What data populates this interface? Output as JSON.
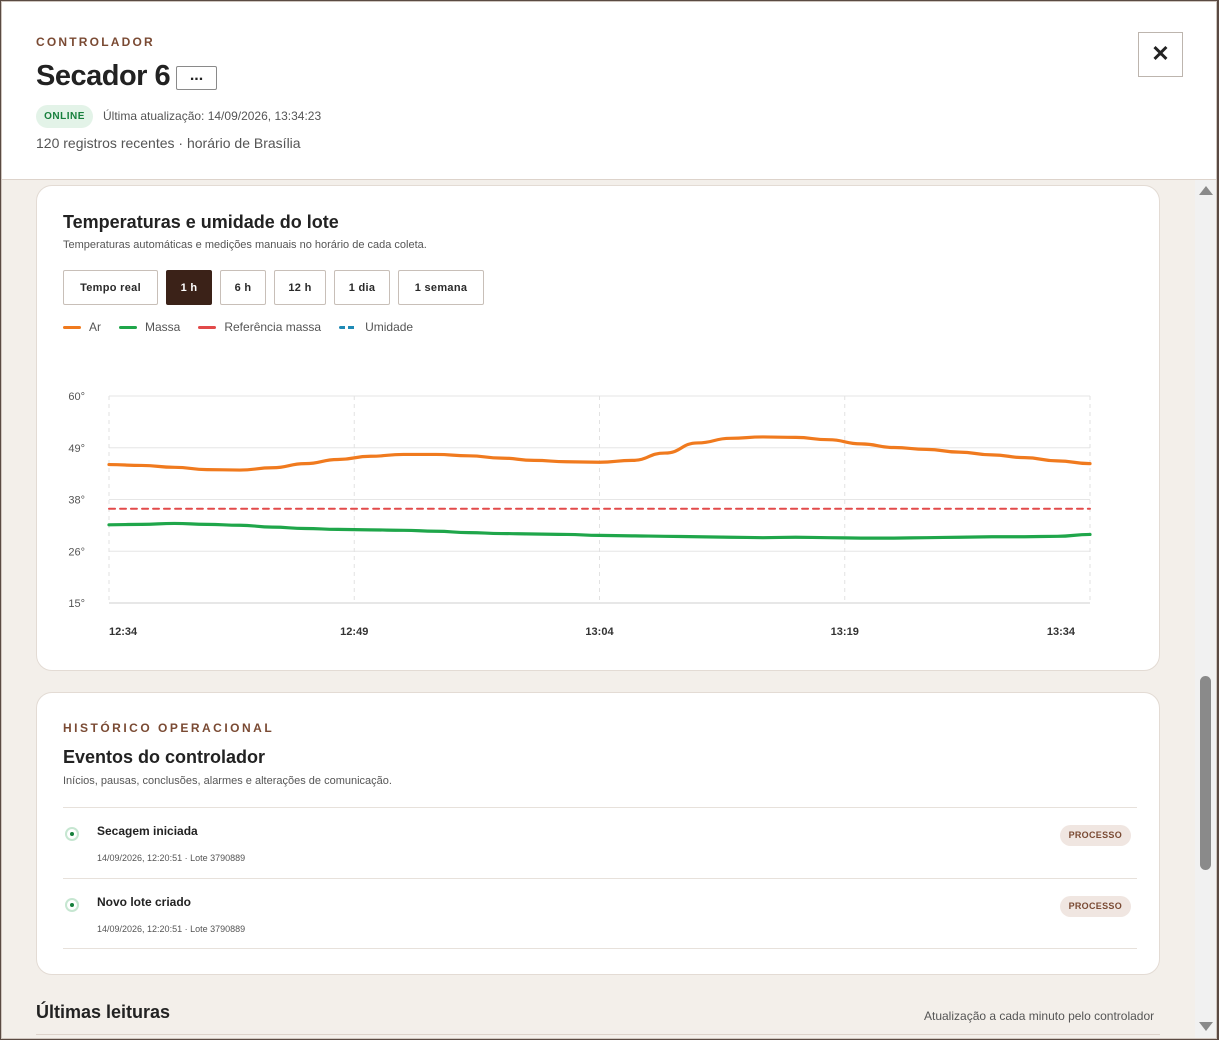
{
  "header": {
    "eyebrow": "CONTROLADOR",
    "title": "Secador 6",
    "more_label": "...",
    "status": "ONLINE",
    "last_update": "Última atualização: 14/09/2026, 13:34:23",
    "records": "120 registros recentes · horário de Brasília",
    "close_label": "✕"
  },
  "chart_card": {
    "title": "Temperaturas e umidade do lote",
    "subtitle": "Temperaturas automáticas e medições manuais no horário de cada coleta.",
    "ranges": [
      {
        "label": "Tempo real",
        "active": false
      },
      {
        "label": "1 h",
        "active": true
      },
      {
        "label": "6 h",
        "active": false
      },
      {
        "label": "12 h",
        "active": false
      },
      {
        "label": "1 dia",
        "active": false
      },
      {
        "label": "1 semana",
        "active": false
      }
    ],
    "legend": [
      {
        "name": "Ar",
        "color": "#f07a1e",
        "style": "solid"
      },
      {
        "name": "Massa",
        "color": "#1fa64a",
        "style": "solid"
      },
      {
        "name": "Referência massa",
        "color": "#e24a4a",
        "style": "solid"
      },
      {
        "name": "Umidade",
        "color": "#1f8ab5",
        "style": "dashed"
      }
    ]
  },
  "chart_data": {
    "type": "line",
    "title": "Temperaturas e umidade do lote",
    "x": [
      "12:34",
      "12:36",
      "12:38",
      "12:40",
      "12:42",
      "12:44",
      "12:46",
      "12:48",
      "12:50",
      "12:52",
      "12:54",
      "12:56",
      "12:58",
      "13:00",
      "13:02",
      "13:04",
      "13:06",
      "13:08",
      "13:10",
      "13:12",
      "13:14",
      "13:16",
      "13:18",
      "13:20",
      "13:22",
      "13:24",
      "13:26",
      "13:28",
      "13:30",
      "13:32",
      "13:34"
    ],
    "x_tick_labels": [
      "12:34",
      "12:49",
      "13:04",
      "13:19",
      "13:34"
    ],
    "y_tick_labels": [
      "60°",
      "49°",
      "38°",
      "26°",
      "15°"
    ],
    "ylim": [
      15,
      60
    ],
    "grid": true,
    "legend_position": "top-left",
    "series": [
      {
        "name": "Ar",
        "color": "#f07a1e",
        "values": [
          45.1,
          44.9,
          44.5,
          44.0,
          43.9,
          44.4,
          45.3,
          46.2,
          46.9,
          47.3,
          47.3,
          47.0,
          46.5,
          46.0,
          45.7,
          45.6,
          46.0,
          47.6,
          49.8,
          50.8,
          51.1,
          51.0,
          50.5,
          49.6,
          48.8,
          48.4,
          47.8,
          47.2,
          46.6,
          45.9,
          45.3
        ]
      },
      {
        "name": "Massa",
        "color": "#1fa64a",
        "values": [
          32.0,
          32.1,
          32.3,
          32.1,
          31.9,
          31.5,
          31.2,
          31.0,
          30.9,
          30.8,
          30.6,
          30.3,
          30.1,
          30.0,
          29.9,
          29.7,
          29.6,
          29.5,
          29.4,
          29.3,
          29.2,
          29.3,
          29.2,
          29.1,
          29.1,
          29.2,
          29.3,
          29.4,
          29.4,
          29.5,
          29.9
        ]
      },
      {
        "name": "Referência massa",
        "color": "#e24a4a",
        "values": [
          35.5,
          35.5,
          35.5,
          35.5,
          35.5,
          35.5,
          35.5,
          35.5,
          35.5,
          35.5,
          35.5,
          35.5,
          35.5,
          35.5,
          35.5,
          35.5,
          35.5,
          35.5,
          35.5,
          35.5,
          35.5,
          35.5,
          35.5,
          35.5,
          35.5,
          35.5,
          35.5,
          35.5,
          35.5,
          35.5,
          35.5
        ]
      }
    ]
  },
  "events_card": {
    "eyebrow": "HISTÓRICO OPERACIONAL",
    "title": "Eventos do controlador",
    "subtitle": "Inícios, pausas, conclusões, alarmes e alterações de comunicação.",
    "items": [
      {
        "name": "Secagem iniciada",
        "meta": "14/09/2026, 12:20:51 · Lote 3790889",
        "tag": "PROCESSO"
      },
      {
        "name": "Novo lote criado",
        "meta": "14/09/2026, 12:20:51 · Lote 3790889",
        "tag": "PROCESSO"
      }
    ]
  },
  "readings": {
    "title": "Últimas leituras",
    "note": "Atualização a cada minuto pelo controlador"
  }
}
